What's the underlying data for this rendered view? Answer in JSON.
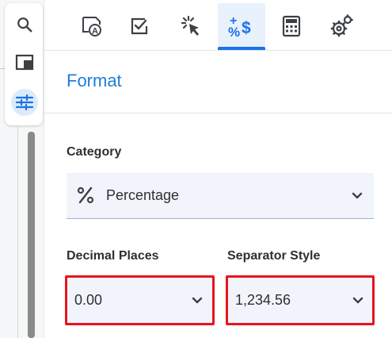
{
  "sidebar": {
    "buttons": [
      {
        "icon": "search-icon"
      },
      {
        "icon": "panel-icon"
      },
      {
        "icon": "sliders-icon",
        "active": true
      }
    ]
  },
  "tabs": [
    {
      "icon": "format-text-icon"
    },
    {
      "icon": "checkbox-icon"
    },
    {
      "icon": "click-icon"
    },
    {
      "icon": "number-format-icon",
      "active": true
    },
    {
      "icon": "calculator-icon"
    },
    {
      "icon": "settings-gears-icon"
    }
  ],
  "panel": {
    "title": "Format",
    "category_label": "Category",
    "category_value": "Percentage",
    "decimal_label": "Decimal Places",
    "decimal_value": "0.00",
    "separator_label": "Separator Style",
    "separator_value": "1,234.56"
  },
  "colors": {
    "accent": "#1a73e8",
    "title": "#1a7fd6",
    "highlight": "#e8141c",
    "select_bg": "#f1f5fb"
  }
}
